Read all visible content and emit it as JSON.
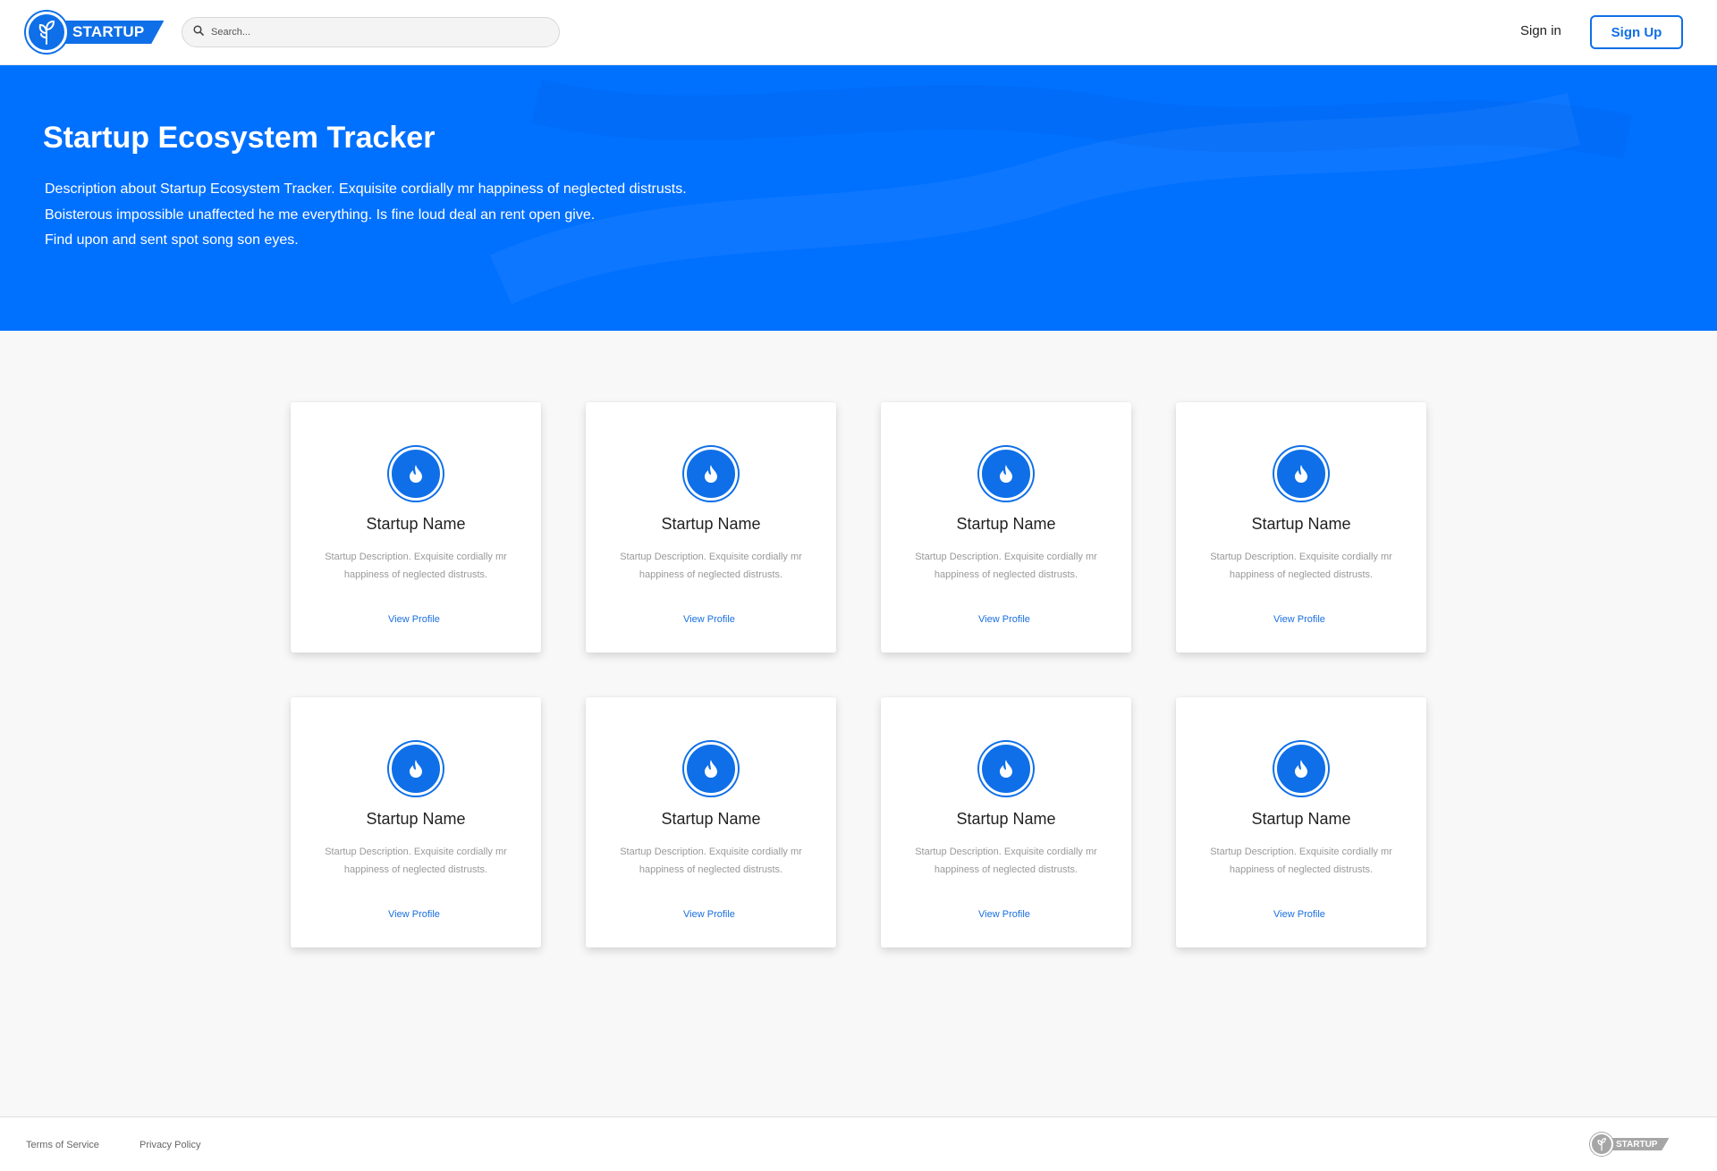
{
  "header": {
    "logo_text": "STARTUP",
    "search_placeholder": "Search...",
    "signin_label": "Sign in",
    "signup_label": "Sign Up"
  },
  "hero": {
    "title": "Startup Ecosystem Tracker",
    "description_lines": [
      "Description about Startup Ecosystem Tracker. Exquisite cordially mr happiness of neglected distrusts.",
      "Boisterous impossible unaffected he me everything. Is fine loud deal an rent open give.",
      "Find upon and sent spot song son eyes."
    ]
  },
  "cards": [
    {
      "name": "Startup Name",
      "desc_line1": "Startup Description. Exquisite cordially mr",
      "desc_line2": "happiness of neglected distrusts.",
      "link": "View Profile",
      "icon": "flame-icon"
    },
    {
      "name": "Startup Name",
      "desc_line1": "Startup Description. Exquisite cordially mr",
      "desc_line2": "happiness of neglected distrusts.",
      "link": "View Profile",
      "icon": "flame-icon"
    },
    {
      "name": "Startup Name",
      "desc_line1": "Startup Description. Exquisite cordially mr",
      "desc_line2": "happiness of neglected distrusts.",
      "link": "View Profile",
      "icon": "flame-icon"
    },
    {
      "name": "Startup Name",
      "desc_line1": "Startup Description. Exquisite cordially mr",
      "desc_line2": "happiness of neglected distrusts.",
      "link": "View Profile",
      "icon": "flame-icon"
    },
    {
      "name": "Startup Name",
      "desc_line1": "Startup Description. Exquisite cordially mr",
      "desc_line2": "happiness of neglected distrusts.",
      "link": "View Profile",
      "icon": "flame-icon"
    },
    {
      "name": "Startup Name",
      "desc_line1": "Startup Description. Exquisite cordially mr",
      "desc_line2": "happiness of neglected distrusts.",
      "link": "View Profile",
      "icon": "flame-icon"
    },
    {
      "name": "Startup Name",
      "desc_line1": "Startup Description. Exquisite cordially mr",
      "desc_line2": "happiness of neglected distrusts.",
      "link": "View Profile",
      "icon": "flame-icon"
    },
    {
      "name": "Startup Name",
      "desc_line1": "Startup Description. Exquisite cordially mr",
      "desc_line2": "happiness of neglected distrusts.",
      "link": "View Profile",
      "icon": "flame-icon"
    }
  ],
  "footer": {
    "terms_label": "Terms of Service",
    "privacy_label": "Privacy Policy",
    "logo_text": "STARTUP"
  },
  "colors": {
    "brand": "#0070ff",
    "accent": "#0f6fe8",
    "link": "#1a6fe0",
    "page_bg": "#f8f8f8"
  }
}
